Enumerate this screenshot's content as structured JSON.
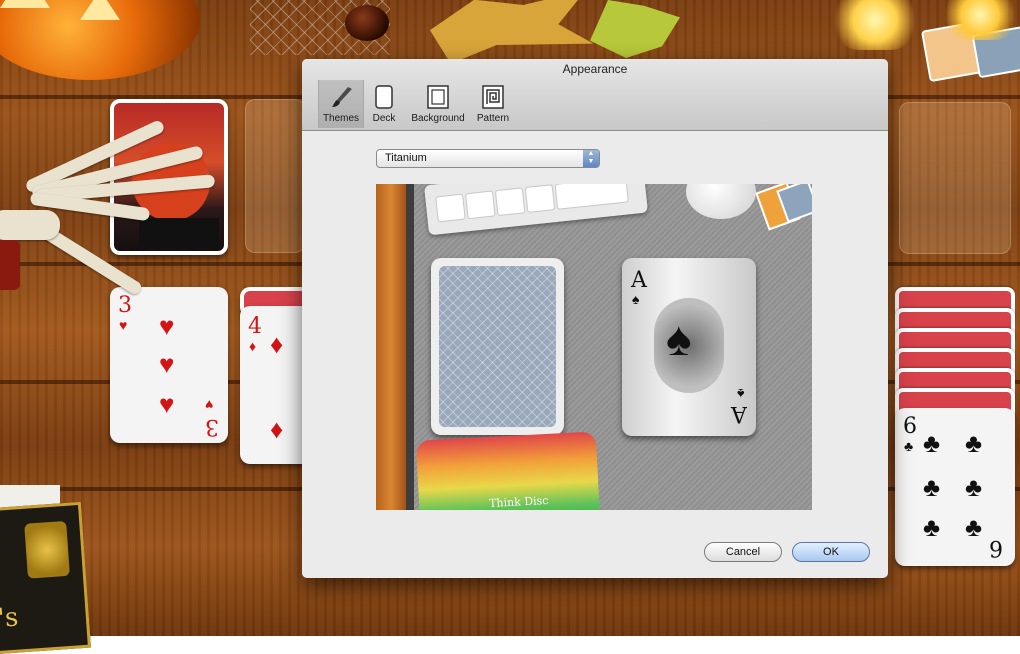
{
  "dialog": {
    "title": "Appearance",
    "toolbar": [
      {
        "label": "Themes",
        "icon": "paintbrush-icon",
        "selected": true
      },
      {
        "label": "Deck",
        "icon": "card-icon",
        "selected": false
      },
      {
        "label": "Background",
        "icon": "picture-frame-icon",
        "selected": false
      },
      {
        "label": "Pattern",
        "icon": "spiral-pattern-icon",
        "selected": false
      }
    ],
    "theme_select": {
      "value": "Titanium"
    },
    "preview": {
      "ace_rank": "A",
      "ace_suit": "♠",
      "rainbow_text": "Think Disc"
    },
    "buttons": {
      "cancel": "Cancel",
      "ok": "OK"
    }
  },
  "table": {
    "card_3": {
      "rank": "3",
      "suit": "♥"
    },
    "card_4": {
      "rank": "4",
      "suit": "♦"
    },
    "card_6": {
      "rank": "6",
      "suit": "♣"
    },
    "book_letter": "'s"
  }
}
